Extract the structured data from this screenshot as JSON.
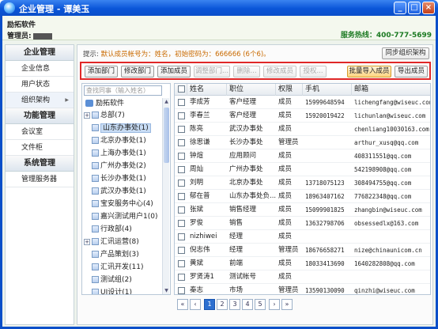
{
  "window": {
    "title": "企业管理 - 谭美玉",
    "icon": "app-globe-icon"
  },
  "header": {
    "company": "励拓软件",
    "admin_label": "管理员:",
    "hotline": "服务热线：400-777-5699"
  },
  "sidebar": {
    "groups": [
      {
        "title": "企业管理",
        "items": [
          "企业信息",
          "用户状态",
          "组织架构"
        ]
      },
      {
        "title": "功能管理",
        "items": [
          "会议室",
          "文件柜"
        ]
      },
      {
        "title": "系统管理",
        "items": [
          "管理服务器"
        ]
      }
    ],
    "active": "组织架构"
  },
  "main": {
    "tip_label": "提示:",
    "tip_text": "默认成员帐号为：姓名，初始密码为：666666 (6个6)。",
    "sync_button": "同步组织架构",
    "toolbar": {
      "add_dept": "添加部门",
      "edit_dept": "修改部门",
      "add_member": "添加成员",
      "adjust_dept": "调整部门...",
      "delete": "删除...",
      "edit_member": "修改成员",
      "authorize": "授权...",
      "batch_import": "批量导入成员",
      "export": "导出成员"
    },
    "tree": {
      "search_placeholder": "查找同事（输入姓名）",
      "root": "励拓软件",
      "head_office": "总部(7)",
      "nodes": [
        "山东办事处(1)",
        "北京办事处(1)",
        "上海办事处(1)",
        "广州办事处(2)",
        "长沙办事处(1)",
        "武汉办事处(1)",
        "宝安服务中心(4)",
        "嘉兴测试用户1(0)",
        "行政部(4)",
        "汇讯运营(8)",
        "产品策划(3)",
        "汇讯开发(11)",
        "测试组(2)",
        "UI设计(1)"
      ],
      "selected": "山东办事处(1)"
    },
    "table": {
      "columns": [
        "姓名",
        "职位",
        "权限",
        "手机",
        "邮箱"
      ],
      "rows": [
        [
          "李成芳",
          "客户经理",
          "成员",
          "15999648594",
          "lichengfang@wiseuc.com"
        ],
        [
          "李春兰",
          "客户经理",
          "成员",
          "15920019422",
          "lichunlan@wiseuc.com"
        ],
        [
          "陈亮",
          "武汉办事处",
          "成员",
          "",
          "chenliang10030163.com"
        ],
        [
          "徐思谦",
          "长沙办事处",
          "管理员",
          "",
          "arthur_xusq@qq.com"
        ],
        [
          "钟煊",
          "应用顾问",
          "成员",
          "",
          "408311551@qq.com"
        ],
        [
          "周灿",
          "广州办事处",
          "成员",
          "",
          "542198908@qq.com"
        ],
        [
          "刘明",
          "北京办事处",
          "成员",
          "13718075123",
          "308494755@qq.com"
        ],
        [
          "郁在普",
          "山东办事处负...",
          "成员",
          "18963407162",
          "776822348@qq.com"
        ],
        [
          "张斌",
          "销售经理",
          "成员",
          "15099901825",
          "zhangbin@wiseuc.com"
        ],
        [
          "罗俊",
          "销售",
          "成员",
          "13632798706",
          "obsessedlx@163.com"
        ],
        [
          "nizhiwei",
          "经理",
          "成员",
          "",
          ""
        ],
        [
          "倪志伟",
          "经理",
          "管理员",
          "18676658271",
          "nize@chinaunicom.cn"
        ],
        [
          "黄斌",
          "前端",
          "成员",
          "18033413690",
          "1640282808@qq.com"
        ],
        [
          "罗贤涛1",
          "测试帐号",
          "成员",
          "",
          ""
        ],
        [
          "秦志",
          "市场",
          "管理员",
          "13590130090",
          "qinzhi@wiseuc.com"
        ]
      ]
    },
    "pager": {
      "first": "«",
      "prev": "‹",
      "pages": [
        "1",
        "2",
        "3",
        "4",
        "5"
      ],
      "current": "1",
      "next": "›",
      "last": "»"
    }
  },
  "colors": {
    "titlebar": "#0a55d8",
    "hotline": "#1c7a22",
    "tip": "#c96a00",
    "highlight_border": "#e02828"
  }
}
